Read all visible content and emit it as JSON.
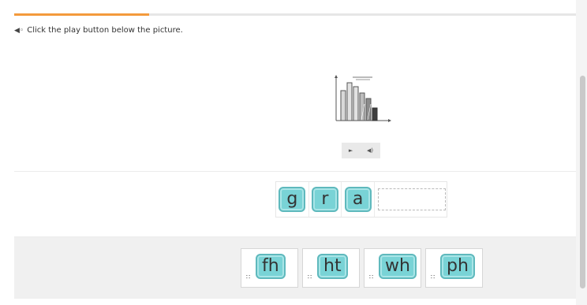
{
  "progress": {
    "fraction": 0.24,
    "color": "#f39a3c"
  },
  "instruction": {
    "icon": "speaker-icon",
    "text": "Click the play button below the picture."
  },
  "picture": {
    "icon": "bar-graph-illustration"
  },
  "media": {
    "play_icon": "►",
    "audio_icon": "◀)"
  },
  "answer": {
    "letters": [
      "g",
      "r",
      "a"
    ]
  },
  "choices": [
    {
      "label": "fh"
    },
    {
      "label": "ht"
    },
    {
      "label": "wh"
    },
    {
      "label": "ph"
    }
  ]
}
